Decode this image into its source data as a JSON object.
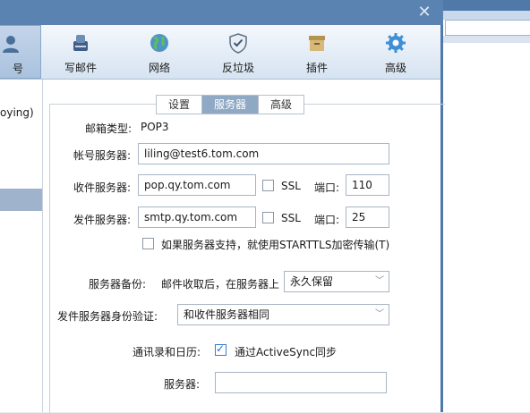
{
  "toolbar": {
    "items": [
      {
        "label": "号",
        "icon": "account-icon"
      },
      {
        "label": "写邮件",
        "icon": "compose-icon"
      },
      {
        "label": "网络",
        "icon": "globe-icon"
      },
      {
        "label": "反垃圾",
        "icon": "shield-icon"
      },
      {
        "label": "插件",
        "icon": "plugin-icon"
      },
      {
        "label": "高级",
        "icon": "gear-icon"
      }
    ]
  },
  "left": {
    "account_text": "oying)"
  },
  "tabs": [
    {
      "label": "设置"
    },
    {
      "label": "服务器"
    },
    {
      "label": "高级"
    }
  ],
  "form": {
    "mailbox_type_label": "邮箱类型:",
    "mailbox_type_value": "POP3",
    "account_server_label": "帐号服务器:",
    "account_server_value": "liling@test6.tom.com",
    "incoming_label": "收件服务器:",
    "incoming_value": "pop.qy.tom.com",
    "incoming_ssl_label": "SSL",
    "incoming_port_label": "端口:",
    "incoming_port_value": "110",
    "outgoing_label": "发件服务器:",
    "outgoing_value": "smtp.qy.tom.com",
    "outgoing_ssl_label": "SSL",
    "outgoing_port_label": "端口:",
    "outgoing_port_value": "25",
    "starttls_label": "如果服务器支持，就使用STARTTLS加密传输(T)",
    "backup_label": "服务器备份:",
    "backup_desc": "邮件收取后，在服务器上",
    "backup_value": "永久保留",
    "auth_label": "发件服务器身份验证:",
    "auth_value": "和收件服务器相同",
    "contacts_label": "通讯录和日历:",
    "activesync_label": "通过ActiveSync同步",
    "server_label": "服务器:",
    "server_value": ""
  },
  "colors": {
    "title_bar": "#5b83b2",
    "tab_active": "#8fa8c4",
    "check_accent": "#1f6fd1"
  }
}
